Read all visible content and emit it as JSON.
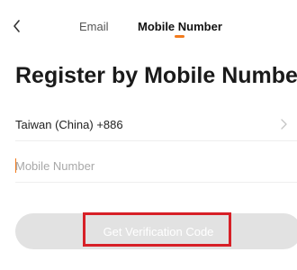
{
  "colors": {
    "accent": "#f27b1d",
    "highlight": "#d72027",
    "button_disabled": "#e2e2e2"
  },
  "header": {
    "back_icon": "chevron-left-icon",
    "tabs": [
      {
        "label": "Email",
        "active": false
      },
      {
        "label": "Mobile Number",
        "active": true
      }
    ]
  },
  "main": {
    "title": "Register by Mobile Number",
    "country": {
      "label": "Taiwan (China) +886",
      "chevron_icon": "chevron-right-icon"
    },
    "phone": {
      "placeholder": "Mobile Number",
      "value": ""
    },
    "verify_button": {
      "label": "Get Verification Code",
      "enabled": false
    }
  }
}
